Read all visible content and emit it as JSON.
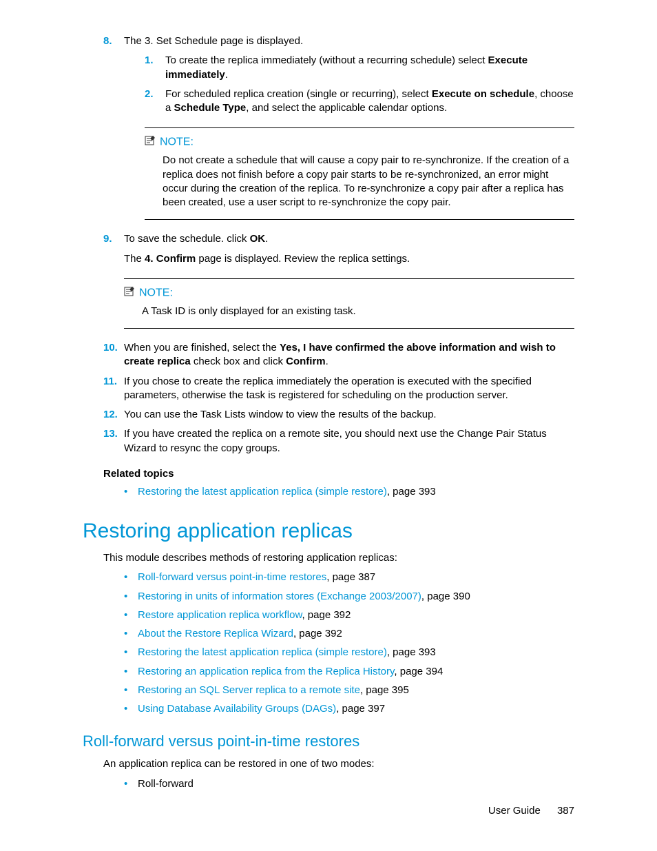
{
  "steps": {
    "s8": {
      "num": "8.",
      "text": "The 3. Set Schedule page is displayed.",
      "sub1_num": "1.",
      "sub1_a": "To create the replica immediately (without a recurring schedule) select ",
      "sub1_b": "Execute immediately",
      "sub1_c": ".",
      "sub2_num": "2.",
      "sub2_a": "For scheduled replica creation (single or recurring), select ",
      "sub2_b": "Execute on schedule",
      "sub2_c": ", choose a ",
      "sub2_d": "Schedule Type",
      "sub2_e": ", and select the applicable calendar options."
    },
    "s9": {
      "num": "9.",
      "text_a": "To save the schedule. click ",
      "text_b": "OK",
      "text_c": ".",
      "para2_a": "The ",
      "para2_b": "4. Confirm",
      "para2_c": " page is displayed. Review the replica settings."
    },
    "s10": {
      "num": "10.",
      "a": "When you are finished, select the ",
      "b": "Yes, I have confirmed the above information and wish to create replica",
      "c": " check box and click ",
      "d": "Confirm",
      "e": "."
    },
    "s11": {
      "num": "11.",
      "text": "If you chose to create the replica immediately the operation is executed with the specified parameters, otherwise the task is registered for scheduling on the production server."
    },
    "s12": {
      "num": "12.",
      "text": "You can use the Task Lists window to view the results of the backup."
    },
    "s13": {
      "num": "13.",
      "text": "If you have created the replica on a remote site, you should next use the Change Pair Status Wizard to resync the copy groups."
    }
  },
  "notes": {
    "n1": {
      "label": "NOTE:",
      "body": "Do not create a schedule that will cause a copy pair to re-synchronize. If the creation of a replica does not finish before a copy pair starts to be re-synchronized, an error might occur during the creation of the replica. To re-synchronize a copy pair after a replica has been created, use a user script to re-synchronize the copy pair."
    },
    "n2": {
      "label": "NOTE:",
      "body": "A Task ID is only displayed for an existing task."
    }
  },
  "related": {
    "title": "Related topics",
    "item1_link": "Restoring the latest application replica (simple restore)",
    "item1_page": ", page 393"
  },
  "section": {
    "title": "Restoring application replicas",
    "intro": "This module describes methods of restoring application replicas:",
    "links": {
      "l1_link": "Roll-forward versus point-in-time restores",
      "l1_page": ", page 387",
      "l2_link": "Restoring in units of information stores (Exchange 2003/2007)",
      "l2_page": ", page 390",
      "l3_link": "Restore application replica workflow",
      "l3_page": ", page 392",
      "l4_link": "About the Restore Replica Wizard",
      "l4_page": ", page 392",
      "l5_link": "Restoring the latest application replica (simple restore)",
      "l5_page": ", page 393",
      "l6_link": "Restoring an application replica from the Replica History",
      "l6_page": ", page 394",
      "l7_link": "Restoring an SQL Server replica to a remote site",
      "l7_page": ", page 395",
      "l8_link": "Using Database Availability Groups (DAGs)",
      "l8_page": ", page 397"
    }
  },
  "subsection": {
    "title": "Roll-forward versus point-in-time restores",
    "intro": "An application replica can be restored in one of two modes:",
    "item1": "Roll-forward"
  },
  "footer": {
    "label": "User Guide",
    "page": "387"
  }
}
